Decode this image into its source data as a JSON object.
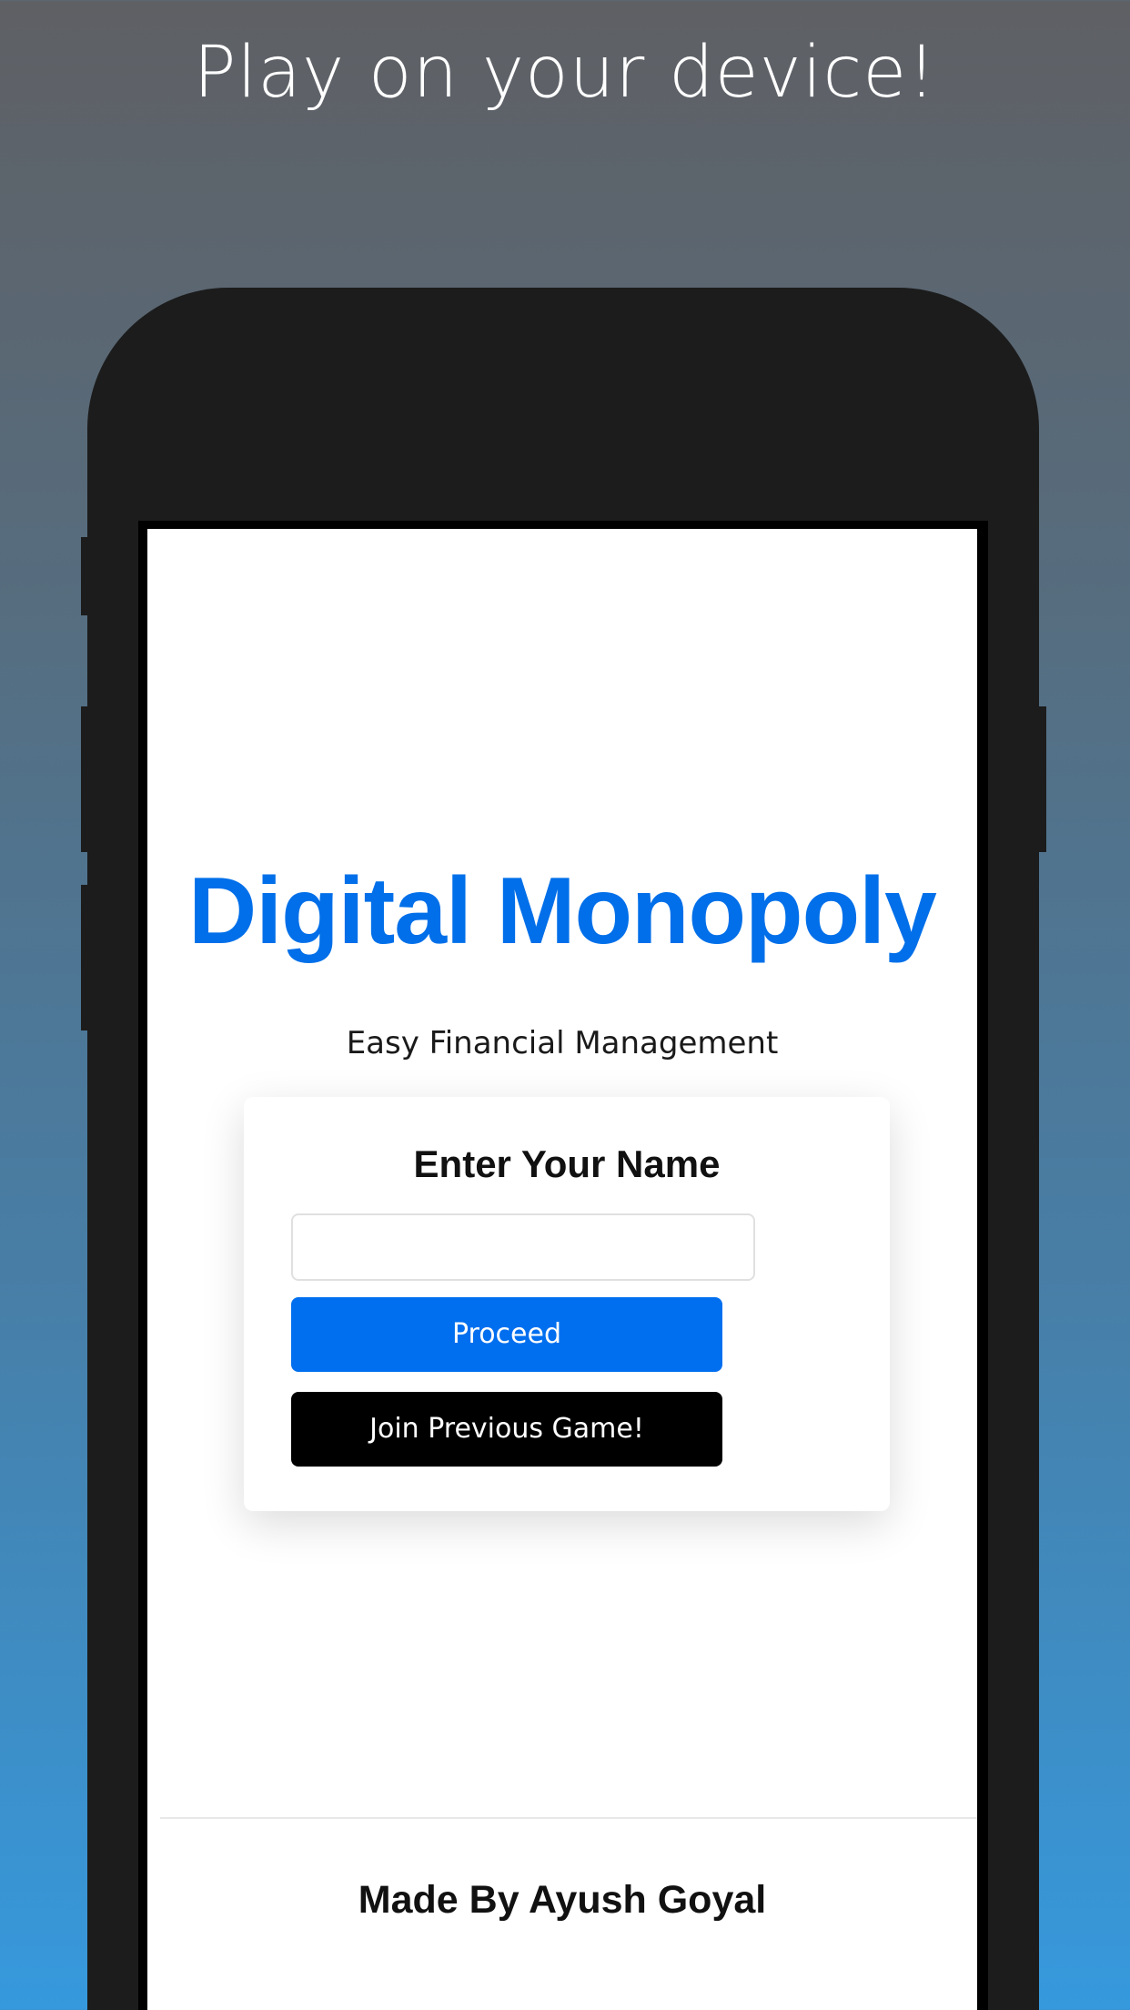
{
  "promo": {
    "headline": "Play on your device!"
  },
  "app": {
    "title": "Digital Monopoly",
    "subtitle": "Easy Financial Management",
    "form": {
      "heading": "Enter Your Name",
      "name_value": "",
      "proceed_label": "Proceed",
      "join_label": "Join Previous Game!"
    },
    "footer": {
      "credit": "Made By Ayush Goyal"
    }
  },
  "colors": {
    "accent": "#006fef",
    "title_blue": "#006fe9",
    "join_button": "#000000",
    "phone_frame": "#1c1c1c"
  }
}
